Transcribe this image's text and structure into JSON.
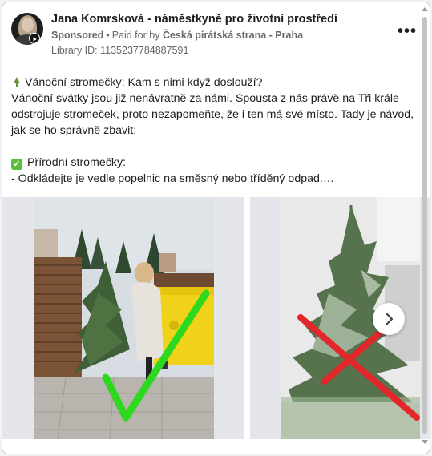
{
  "post": {
    "page_name": "Jana Komrsková - náměstkyně pro životní prostředí",
    "sponsored_label": "Sponsored",
    "separator": "•",
    "paid_for_label": "Paid for by",
    "payer": "Česká pirátská strana - Praha",
    "library_id": "Library ID: 1135237784887591",
    "more_icon": "more-horizontal-icon",
    "more_label": "•••"
  },
  "body": {
    "headline": "Vánoční stromečky: Kam s nimi když doslouží?",
    "paragraph": "Vánoční svátky jsou již nenávratně za námi. Spousta z nás právě na Tři krále odstrojuje stromeček, proto nezapomeňte, že i ten má své místo. Tady je návod, jak se ho správně zbavit:",
    "section_title": "Přírodní stromečky:",
    "section_line": "- Odkládejte je vedle popelnic na směsný nebo tříděný odpad.…",
    "tree_icon": "christmas-tree-icon",
    "check_icon": "check-mark-icon",
    "check_glyph": "✓"
  },
  "carousel": {
    "next_icon": "chevron-right-icon",
    "slides": [
      {
        "image": "woman-placing-tree-next-to-yellow-bins-with-green-check"
      },
      {
        "image": "christmas-tree-indoors-with-red-cross"
      }
    ]
  },
  "colors": {
    "accent_green": "#2ed81f",
    "cross_red": "#e3262a",
    "bin_yellow": "#f1d21a",
    "text": "#1c1e21",
    "muted": "#65676b"
  }
}
